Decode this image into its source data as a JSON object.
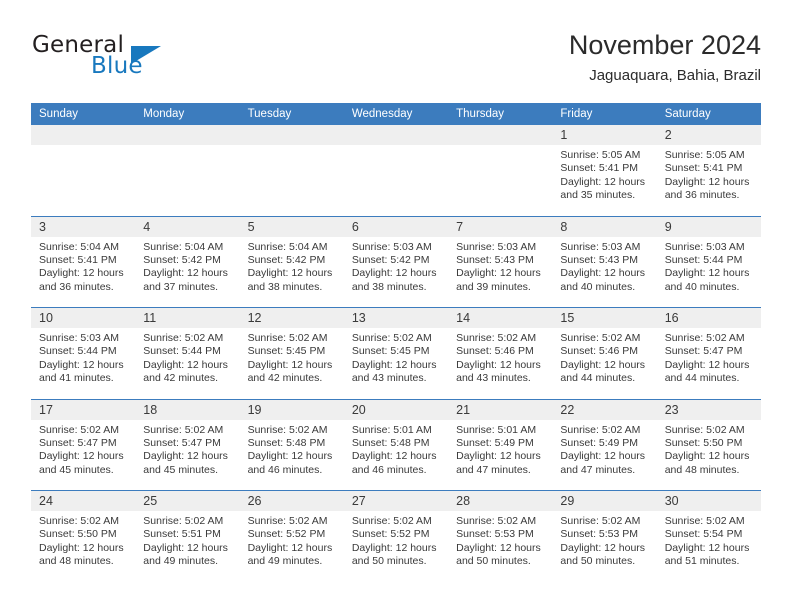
{
  "brand": {
    "name_top": "General",
    "name_bottom": "Blue",
    "triangle_icon": "triangle-icon",
    "color_blue": "#1878be",
    "color_dark": "#231f20"
  },
  "header": {
    "title": "November 2024",
    "subtitle": "Jaguaquara, Bahia, Brazil"
  },
  "theme": {
    "header_blue": "#3c7cbe",
    "daynum_gray": "#efefef",
    "text": "#3a3a3a"
  },
  "weekdays": [
    "Sunday",
    "Monday",
    "Tuesday",
    "Wednesday",
    "Thursday",
    "Friday",
    "Saturday"
  ],
  "weeks": [
    {
      "days": [
        {
          "num": "",
          "sunrise": "",
          "sunset": "",
          "daylight_1": "",
          "daylight_2": ""
        },
        {
          "num": "",
          "sunrise": "",
          "sunset": "",
          "daylight_1": "",
          "daylight_2": ""
        },
        {
          "num": "",
          "sunrise": "",
          "sunset": "",
          "daylight_1": "",
          "daylight_2": ""
        },
        {
          "num": "",
          "sunrise": "",
          "sunset": "",
          "daylight_1": "",
          "daylight_2": ""
        },
        {
          "num": "",
          "sunrise": "",
          "sunset": "",
          "daylight_1": "",
          "daylight_2": ""
        },
        {
          "num": "1",
          "sunrise": "Sunrise: 5:05 AM",
          "sunset": "Sunset: 5:41 PM",
          "daylight_1": "Daylight: 12 hours",
          "daylight_2": "and 35 minutes."
        },
        {
          "num": "2",
          "sunrise": "Sunrise: 5:05 AM",
          "sunset": "Sunset: 5:41 PM",
          "daylight_1": "Daylight: 12 hours",
          "daylight_2": "and 36 minutes."
        }
      ]
    },
    {
      "days": [
        {
          "num": "3",
          "sunrise": "Sunrise: 5:04 AM",
          "sunset": "Sunset: 5:41 PM",
          "daylight_1": "Daylight: 12 hours",
          "daylight_2": "and 36 minutes."
        },
        {
          "num": "4",
          "sunrise": "Sunrise: 5:04 AM",
          "sunset": "Sunset: 5:42 PM",
          "daylight_1": "Daylight: 12 hours",
          "daylight_2": "and 37 minutes."
        },
        {
          "num": "5",
          "sunrise": "Sunrise: 5:04 AM",
          "sunset": "Sunset: 5:42 PM",
          "daylight_1": "Daylight: 12 hours",
          "daylight_2": "and 38 minutes."
        },
        {
          "num": "6",
          "sunrise": "Sunrise: 5:03 AM",
          "sunset": "Sunset: 5:42 PM",
          "daylight_1": "Daylight: 12 hours",
          "daylight_2": "and 38 minutes."
        },
        {
          "num": "7",
          "sunrise": "Sunrise: 5:03 AM",
          "sunset": "Sunset: 5:43 PM",
          "daylight_1": "Daylight: 12 hours",
          "daylight_2": "and 39 minutes."
        },
        {
          "num": "8",
          "sunrise": "Sunrise: 5:03 AM",
          "sunset": "Sunset: 5:43 PM",
          "daylight_1": "Daylight: 12 hours",
          "daylight_2": "and 40 minutes."
        },
        {
          "num": "9",
          "sunrise": "Sunrise: 5:03 AM",
          "sunset": "Sunset: 5:44 PM",
          "daylight_1": "Daylight: 12 hours",
          "daylight_2": "and 40 minutes."
        }
      ]
    },
    {
      "days": [
        {
          "num": "10",
          "sunrise": "Sunrise: 5:03 AM",
          "sunset": "Sunset: 5:44 PM",
          "daylight_1": "Daylight: 12 hours",
          "daylight_2": "and 41 minutes."
        },
        {
          "num": "11",
          "sunrise": "Sunrise: 5:02 AM",
          "sunset": "Sunset: 5:44 PM",
          "daylight_1": "Daylight: 12 hours",
          "daylight_2": "and 42 minutes."
        },
        {
          "num": "12",
          "sunrise": "Sunrise: 5:02 AM",
          "sunset": "Sunset: 5:45 PM",
          "daylight_1": "Daylight: 12 hours",
          "daylight_2": "and 42 minutes."
        },
        {
          "num": "13",
          "sunrise": "Sunrise: 5:02 AM",
          "sunset": "Sunset: 5:45 PM",
          "daylight_1": "Daylight: 12 hours",
          "daylight_2": "and 43 minutes."
        },
        {
          "num": "14",
          "sunrise": "Sunrise: 5:02 AM",
          "sunset": "Sunset: 5:46 PM",
          "daylight_1": "Daylight: 12 hours",
          "daylight_2": "and 43 minutes."
        },
        {
          "num": "15",
          "sunrise": "Sunrise: 5:02 AM",
          "sunset": "Sunset: 5:46 PM",
          "daylight_1": "Daylight: 12 hours",
          "daylight_2": "and 44 minutes."
        },
        {
          "num": "16",
          "sunrise": "Sunrise: 5:02 AM",
          "sunset": "Sunset: 5:47 PM",
          "daylight_1": "Daylight: 12 hours",
          "daylight_2": "and 44 minutes."
        }
      ]
    },
    {
      "days": [
        {
          "num": "17",
          "sunrise": "Sunrise: 5:02 AM",
          "sunset": "Sunset: 5:47 PM",
          "daylight_1": "Daylight: 12 hours",
          "daylight_2": "and 45 minutes."
        },
        {
          "num": "18",
          "sunrise": "Sunrise: 5:02 AM",
          "sunset": "Sunset: 5:47 PM",
          "daylight_1": "Daylight: 12 hours",
          "daylight_2": "and 45 minutes."
        },
        {
          "num": "19",
          "sunrise": "Sunrise: 5:02 AM",
          "sunset": "Sunset: 5:48 PM",
          "daylight_1": "Daylight: 12 hours",
          "daylight_2": "and 46 minutes."
        },
        {
          "num": "20",
          "sunrise": "Sunrise: 5:01 AM",
          "sunset": "Sunset: 5:48 PM",
          "daylight_1": "Daylight: 12 hours",
          "daylight_2": "and 46 minutes."
        },
        {
          "num": "21",
          "sunrise": "Sunrise: 5:01 AM",
          "sunset": "Sunset: 5:49 PM",
          "daylight_1": "Daylight: 12 hours",
          "daylight_2": "and 47 minutes."
        },
        {
          "num": "22",
          "sunrise": "Sunrise: 5:02 AM",
          "sunset": "Sunset: 5:49 PM",
          "daylight_1": "Daylight: 12 hours",
          "daylight_2": "and 47 minutes."
        },
        {
          "num": "23",
          "sunrise": "Sunrise: 5:02 AM",
          "sunset": "Sunset: 5:50 PM",
          "daylight_1": "Daylight: 12 hours",
          "daylight_2": "and 48 minutes."
        }
      ]
    },
    {
      "days": [
        {
          "num": "24",
          "sunrise": "Sunrise: 5:02 AM",
          "sunset": "Sunset: 5:50 PM",
          "daylight_1": "Daylight: 12 hours",
          "daylight_2": "and 48 minutes."
        },
        {
          "num": "25",
          "sunrise": "Sunrise: 5:02 AM",
          "sunset": "Sunset: 5:51 PM",
          "daylight_1": "Daylight: 12 hours",
          "daylight_2": "and 49 minutes."
        },
        {
          "num": "26",
          "sunrise": "Sunrise: 5:02 AM",
          "sunset": "Sunset: 5:52 PM",
          "daylight_1": "Daylight: 12 hours",
          "daylight_2": "and 49 minutes."
        },
        {
          "num": "27",
          "sunrise": "Sunrise: 5:02 AM",
          "sunset": "Sunset: 5:52 PM",
          "daylight_1": "Daylight: 12 hours",
          "daylight_2": "and 50 minutes."
        },
        {
          "num": "28",
          "sunrise": "Sunrise: 5:02 AM",
          "sunset": "Sunset: 5:53 PM",
          "daylight_1": "Daylight: 12 hours",
          "daylight_2": "and 50 minutes."
        },
        {
          "num": "29",
          "sunrise": "Sunrise: 5:02 AM",
          "sunset": "Sunset: 5:53 PM",
          "daylight_1": "Daylight: 12 hours",
          "daylight_2": "and 50 minutes."
        },
        {
          "num": "30",
          "sunrise": "Sunrise: 5:02 AM",
          "sunset": "Sunset: 5:54 PM",
          "daylight_1": "Daylight: 12 hours",
          "daylight_2": "and 51 minutes."
        }
      ]
    }
  ]
}
